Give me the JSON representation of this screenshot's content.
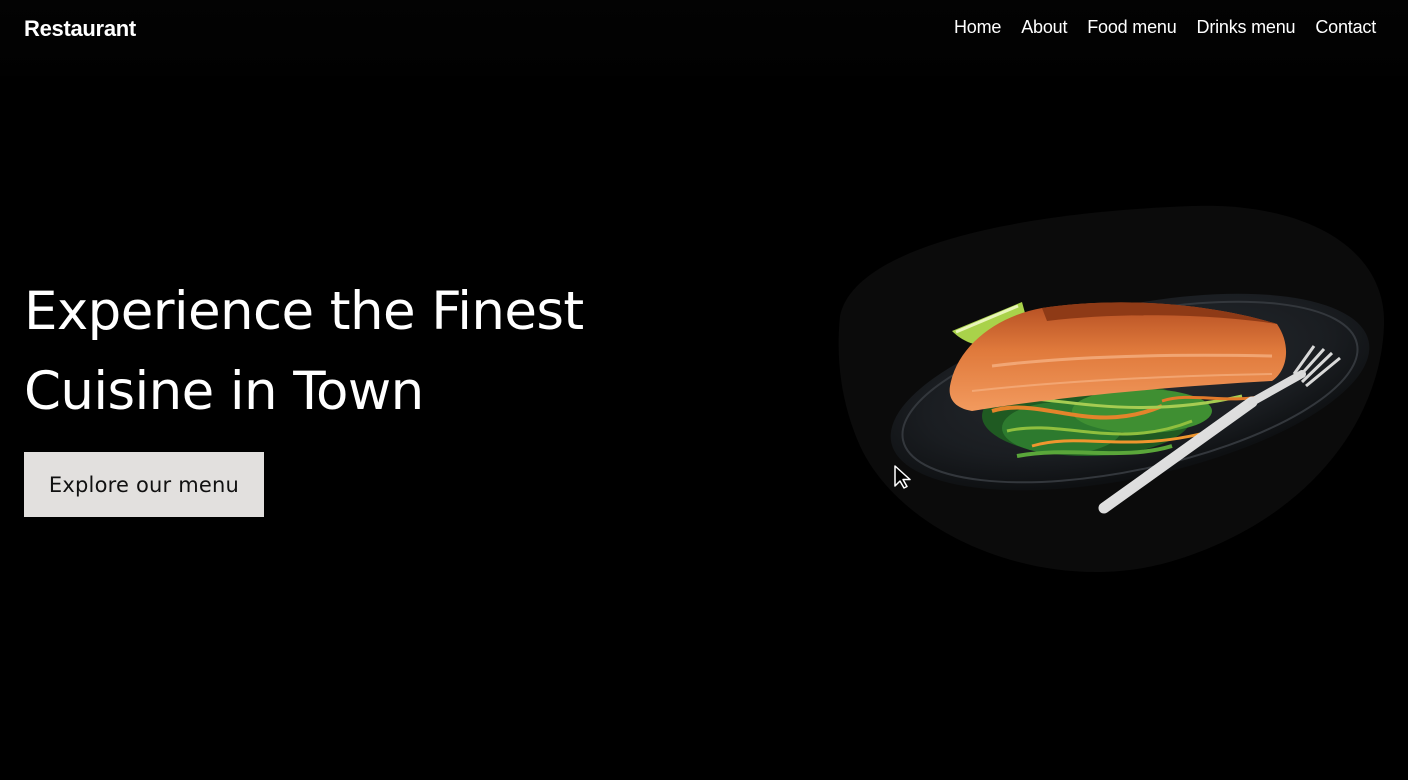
{
  "header": {
    "brand": "Restaurant",
    "nav": [
      "Home",
      "About",
      "Food menu",
      "Drinks menu",
      "Contact"
    ]
  },
  "hero": {
    "title_line1": "Experience the Finest",
    "title_line2": "Cuisine in Town",
    "cta_label": "Explore our menu"
  },
  "colors": {
    "background": "#000000",
    "text": "#ffffff",
    "button_bg": "#e2e0de",
    "button_text": "#111111",
    "blob": "#0b0b0b"
  },
  "icons": {
    "cursor": "pointer-cursor-icon",
    "hero_image": "salmon-plate-image"
  }
}
